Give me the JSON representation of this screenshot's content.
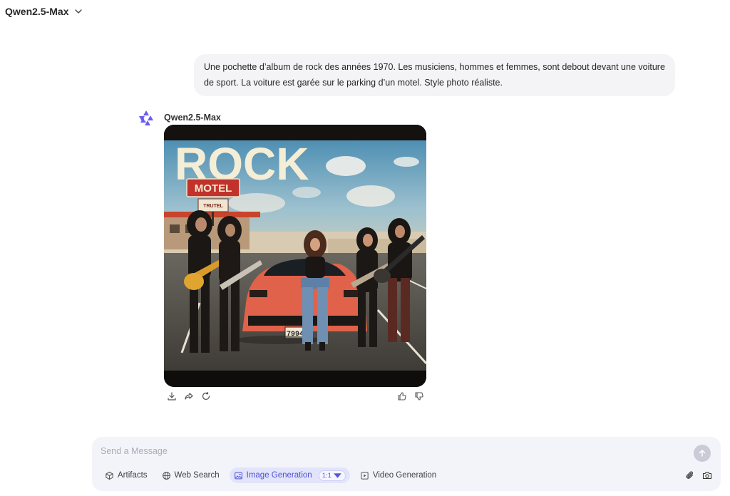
{
  "header": {
    "model_name": "Qwen2.5-Max"
  },
  "user_message": {
    "text": "Une pochette d’album de rock des années 1970. Les musiciens, hommes et femmes, sont debout devant une voiture de sport. La voiture est garée sur le parking d’un motel. Style photo réaliste."
  },
  "assistant_message": {
    "model_name": "Qwen2.5-Max",
    "image": {
      "headline": "ROCK",
      "sign_motel": "MOTEL",
      "sign_small": "TRUTEL",
      "plate": "7994"
    },
    "actions": [
      "download-icon",
      "share-icon",
      "regenerate-icon"
    ],
    "feedback": [
      "thumbs-up-icon",
      "thumbs-down-icon"
    ]
  },
  "composer": {
    "placeholder": "Send a Message",
    "tools": {
      "artifacts": "Artifacts",
      "web_search": "Web Search",
      "image_generation": "Image Generation",
      "aspect_ratio": "1:1",
      "video_generation": "Video Generation"
    }
  },
  "colors": {
    "accent": "#4f4fd6",
    "accent_bg": "#e2e4fb",
    "composer_bg": "#f3f4fa",
    "bubble_bg": "#f4f4f6"
  }
}
